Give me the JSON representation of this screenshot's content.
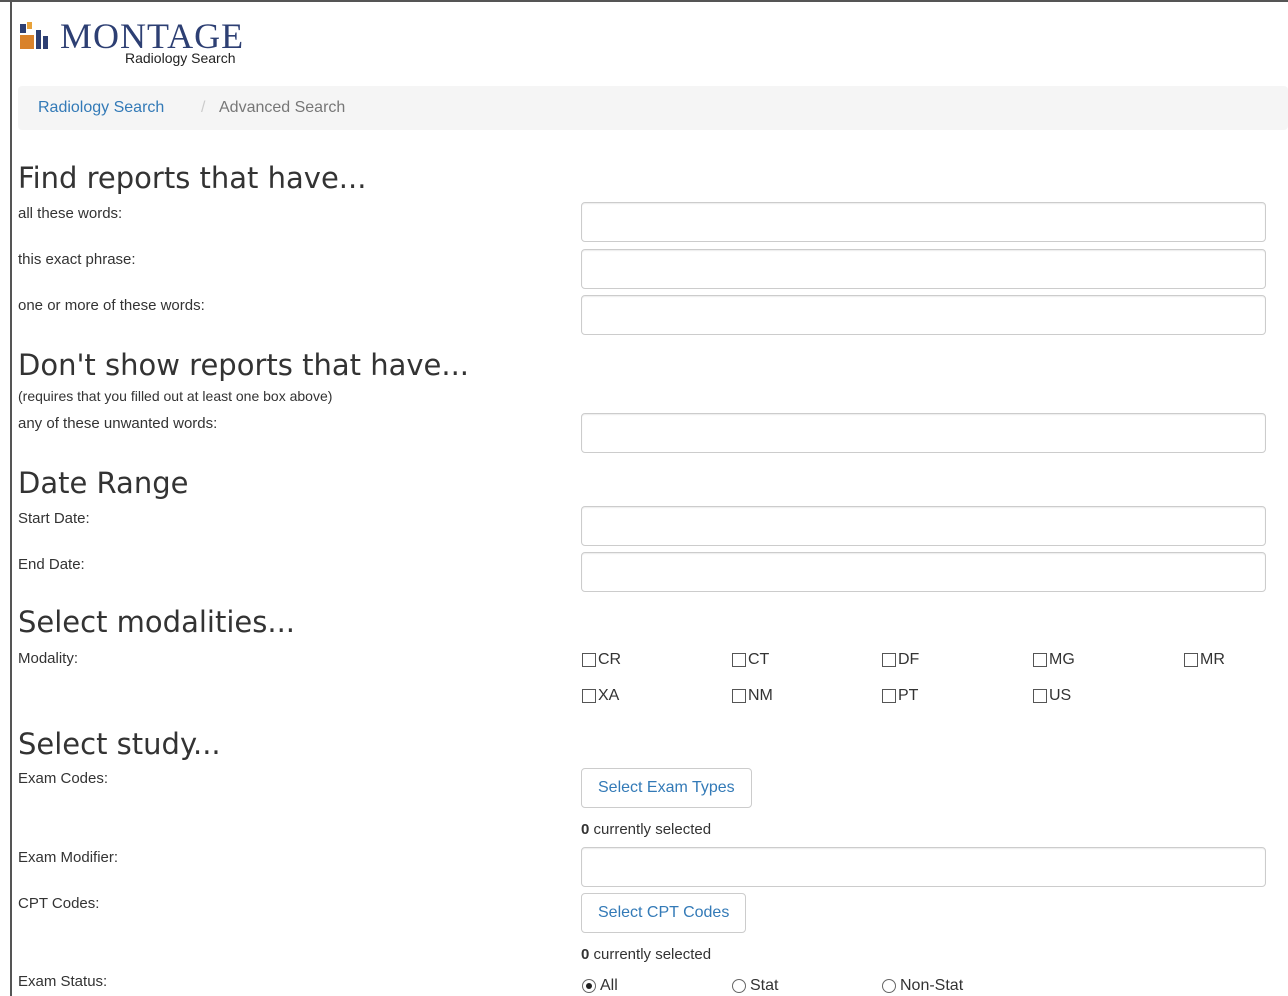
{
  "header": {
    "brand": "MONTAGE",
    "subtitle": "Radiology Search",
    "logo_icon": "montage-logo-icon"
  },
  "breadcrumb": {
    "link": "Radiology Search",
    "separator": "/",
    "current": "Advanced Search"
  },
  "find_section": {
    "heading": "Find reports that have...",
    "fields": [
      {
        "label": "all these words:",
        "value": ""
      },
      {
        "label": "this exact phrase:",
        "value": ""
      },
      {
        "label": "one or more of these words:",
        "value": ""
      }
    ]
  },
  "exclude_section": {
    "heading": "Don't show reports that have...",
    "note": "(requires that you filled out at least one box above)",
    "fields": [
      {
        "label": "any of these unwanted words:",
        "value": ""
      }
    ]
  },
  "date_section": {
    "heading": "Date Range",
    "fields": [
      {
        "label": "Start Date:",
        "value": ""
      },
      {
        "label": "End Date:",
        "value": ""
      }
    ]
  },
  "modality_section": {
    "heading": "Select modalities...",
    "label": "Modality:",
    "options": [
      {
        "label": "CR",
        "checked": false
      },
      {
        "label": "CT",
        "checked": false
      },
      {
        "label": "DF",
        "checked": false
      },
      {
        "label": "MG",
        "checked": false
      },
      {
        "label": "MR",
        "checked": false
      },
      {
        "label": "XA",
        "checked": false
      },
      {
        "label": "NM",
        "checked": false
      },
      {
        "label": "PT",
        "checked": false
      },
      {
        "label": "US",
        "checked": false
      }
    ]
  },
  "study_section": {
    "heading": "Select study...",
    "exam_codes_label": "Exam Codes:",
    "exam_types_button": "Select Exam Types",
    "exam_selected_count": "0",
    "exam_selected_suffix": " currently selected",
    "exam_modifier_label": "Exam Modifier:",
    "exam_modifier_value": "",
    "cpt_codes_label": "CPT Codes:",
    "cpt_button": "Select CPT Codes",
    "cpt_selected_count": "0",
    "cpt_selected_suffix": " currently selected",
    "exam_status_label": "Exam Status:",
    "status_options": [
      {
        "label": "All",
        "selected": true
      },
      {
        "label": "Stat",
        "selected": false
      },
      {
        "label": "Non-Stat",
        "selected": false
      }
    ]
  }
}
